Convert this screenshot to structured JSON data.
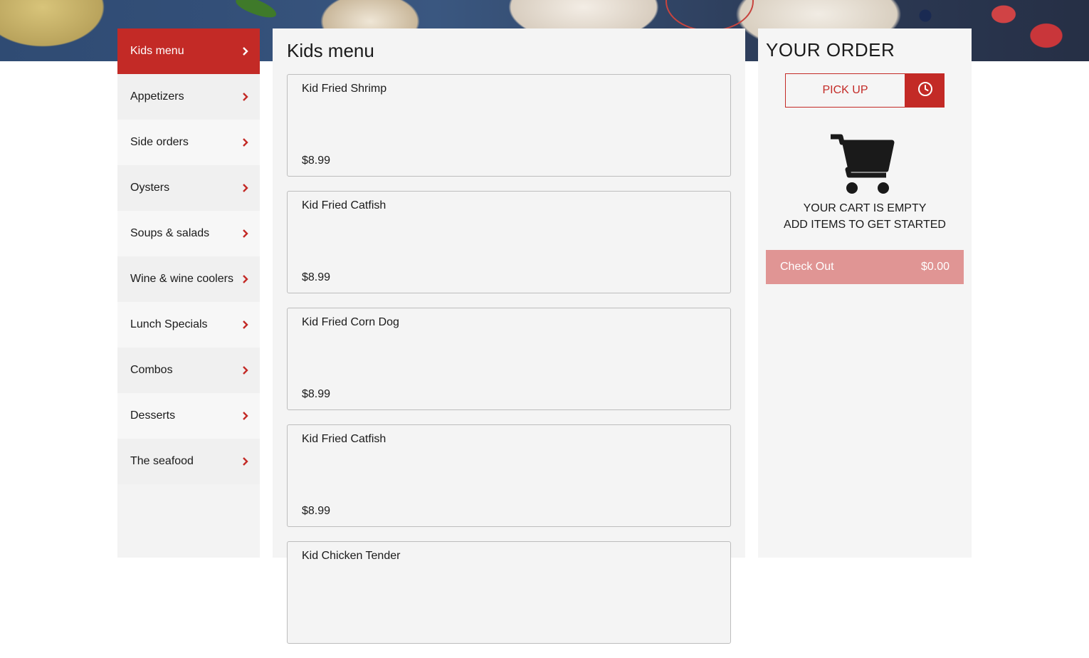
{
  "sidebar": {
    "items": [
      {
        "label": "Kids menu",
        "active": true
      },
      {
        "label": "Appetizers"
      },
      {
        "label": "Side orders"
      },
      {
        "label": "Oysters"
      },
      {
        "label": "Soups & salads"
      },
      {
        "label": "Wine & wine coolers"
      },
      {
        "label": "Lunch Specials"
      },
      {
        "label": "Combos"
      },
      {
        "label": "Desserts"
      },
      {
        "label": "The seafood"
      }
    ]
  },
  "main": {
    "title": "Kids menu",
    "items": [
      {
        "name": "Kid Fried Shrimp",
        "price": "$8.99"
      },
      {
        "name": "Kid Fried Catfish",
        "price": "$8.99"
      },
      {
        "name": "Kid Fried Corn Dog",
        "price": "$8.99"
      },
      {
        "name": "Kid Fried Catfish",
        "price": "$8.99"
      },
      {
        "name": "Kid Chicken Tender",
        "price": ""
      }
    ]
  },
  "order": {
    "title": "YOUR ORDER",
    "pickup_label": "PICK UP",
    "empty_line1": "YOUR CART IS EMPTY",
    "empty_line2": "ADD ITEMS TO GET STARTED",
    "checkout_label": "Check Out",
    "checkout_total": "$0.00"
  },
  "icons": {
    "nav": "chevron-right-icon",
    "schedule": "clock-icon",
    "cart": "shopping-cart-icon"
  },
  "colors": {
    "accent": "#c32a26",
    "checkout_disabled": "#e09594",
    "panel_bg": "#f4f4f4"
  }
}
